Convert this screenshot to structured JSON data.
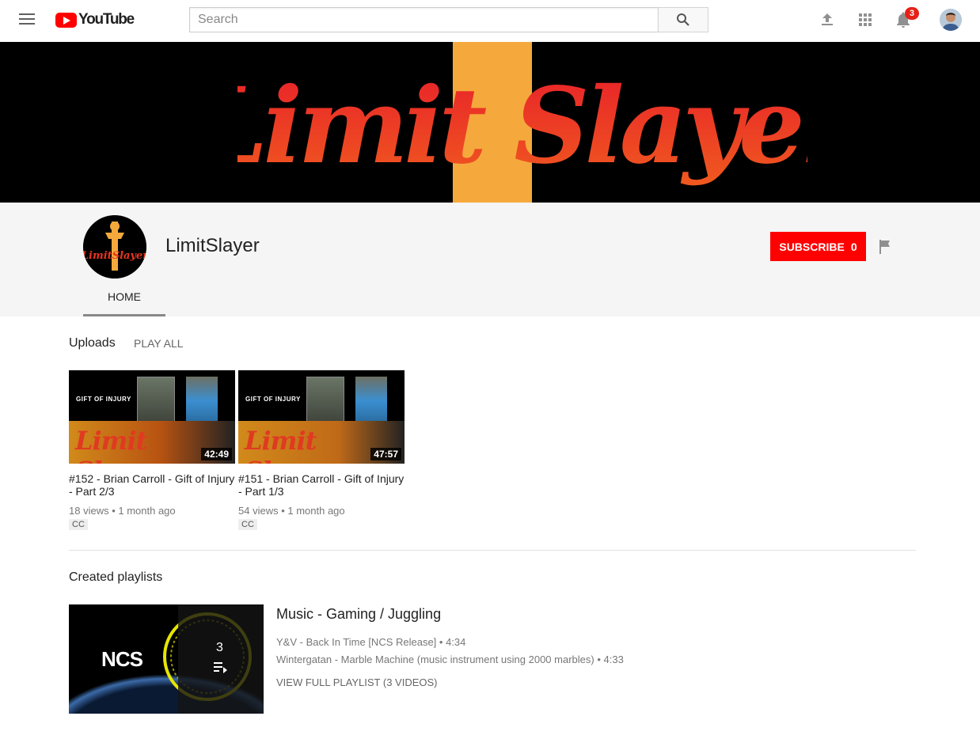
{
  "header": {
    "logo_text": "YouTube",
    "search_placeholder": "Search",
    "notification_count": "3",
    "icons": [
      "menu-icon",
      "search-icon",
      "upload-icon",
      "apps-grid-icon",
      "bell-icon",
      "avatar"
    ]
  },
  "banner": {
    "logo_text": "Limit Slayer",
    "colors": {
      "background": "#000000",
      "stripe": "#f5a93c",
      "script": "#e8341f"
    }
  },
  "channel": {
    "name": "LimitSlayer",
    "avatar_text": "LimitSlayer",
    "subscribe_label": "SUBSCRIBE",
    "subscriber_count": "0",
    "tabs": [
      {
        "label": "HOME",
        "active": true
      }
    ]
  },
  "uploads": {
    "title": "Uploads",
    "play_all": "PLAY ALL",
    "videos": [
      {
        "title": "#152 - Brian Carroll - Gift of Injury - Part 2/3",
        "duration": "42:49",
        "views": "18 views",
        "age": "1 month ago",
        "badge": "CC",
        "thumb_heading": "GIFT OF INJURY",
        "thumb_brand": "Limit Slayer"
      },
      {
        "title": "#151 - Brian Carroll - Gift of Injury - Part 1/3",
        "duration": "47:57",
        "views": "54 views",
        "age": "1 month ago",
        "badge": "CC",
        "thumb_heading": "GIFT OF INJURY",
        "thumb_brand": "Limit Slayer"
      }
    ]
  },
  "playlists": {
    "title": "Created playlists",
    "items": [
      {
        "title": "Music - Gaming / Juggling",
        "video_count": "3",
        "thumb_logo": "NCS",
        "entries": [
          {
            "name": "Y&V - Back In Time [NCS Release]",
            "duration": "4:34"
          },
          {
            "name": "Wintergatan - Marble Machine (music instrument using 2000 marbles)",
            "duration": "4:33"
          }
        ],
        "view_full": "VIEW FULL PLAYLIST (3 VIDEOS)"
      }
    ]
  },
  "colors": {
    "brand_red": "#ff0000",
    "text_secondary": "#777777"
  }
}
